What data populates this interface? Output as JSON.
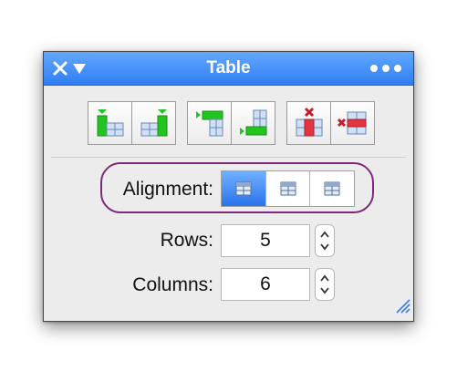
{
  "window": {
    "title": "Table"
  },
  "toolbar": {
    "groups": [
      {
        "name": "insert-columns",
        "buttons": [
          {
            "icon": "insert-column-left-icon"
          },
          {
            "icon": "insert-column-right-icon"
          }
        ]
      },
      {
        "name": "insert-rows",
        "buttons": [
          {
            "icon": "insert-row-above-icon"
          },
          {
            "icon": "insert-row-below-icon"
          }
        ]
      },
      {
        "name": "delete",
        "buttons": [
          {
            "icon": "delete-column-icon"
          },
          {
            "icon": "delete-row-icon"
          }
        ]
      }
    ]
  },
  "alignment": {
    "label": "Alignment:",
    "options": [
      "left",
      "center",
      "right"
    ],
    "selected": "left"
  },
  "rows": {
    "label": "Rows:",
    "value": "5"
  },
  "columns": {
    "label": "Columns:",
    "value": "6"
  },
  "colors": {
    "titlebar": "#2f7df2",
    "insert": "#22c41e",
    "delete": "#e2353f",
    "highlight_ring": "#7b2a78",
    "selected_segment": "#2a74ea"
  }
}
